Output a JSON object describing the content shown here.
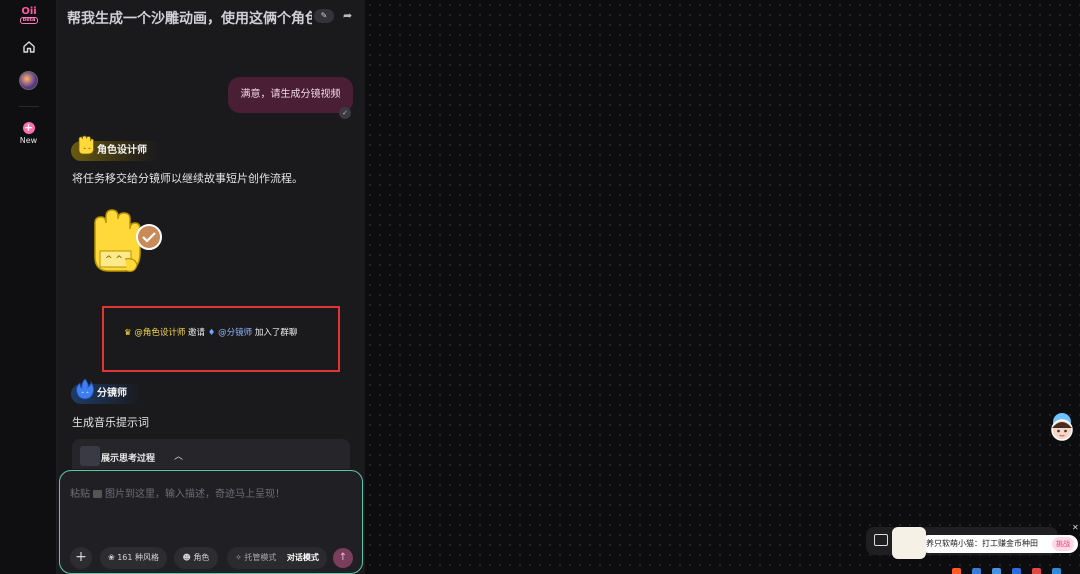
{
  "app": {
    "logo_text": "Oii",
    "logo_sub": "beta",
    "new_label": "New"
  },
  "chat": {
    "title": "帮我生成一个沙雕动画，使用这俩个角色…",
    "user_message": "满意，请生成分镜视频",
    "agents": {
      "designer": "角色设计师",
      "storyboard": "分镜师"
    },
    "designer_message": "将任务移交给分镜师以继续故事短片创作流程。",
    "system_event": {
      "from": "@角色设计师",
      "action": "邀请",
      "to": "@分镜师",
      "suffix": "加入了群聊"
    },
    "storyboard_message": "生成音乐提示词",
    "thinking_label": "展示思考过程"
  },
  "composer": {
    "placeholder_prefix": "粘贴",
    "placeholder_suffix": "图片到这里，输入描述，奇迹马上呈现！",
    "styles_label": "161 种风格",
    "role_label": "角色",
    "mode_auto": "托管模式",
    "mode_chat": "对话模式"
  },
  "overlay": {
    "popup_text": "养只软萌小猫：打工赚金币种田",
    "popup_badge": "挑战"
  },
  "colors": {
    "accent_pink": "#ff6fb0",
    "highlight_box": "#e03535",
    "composer_border": "#5ec6a9"
  }
}
